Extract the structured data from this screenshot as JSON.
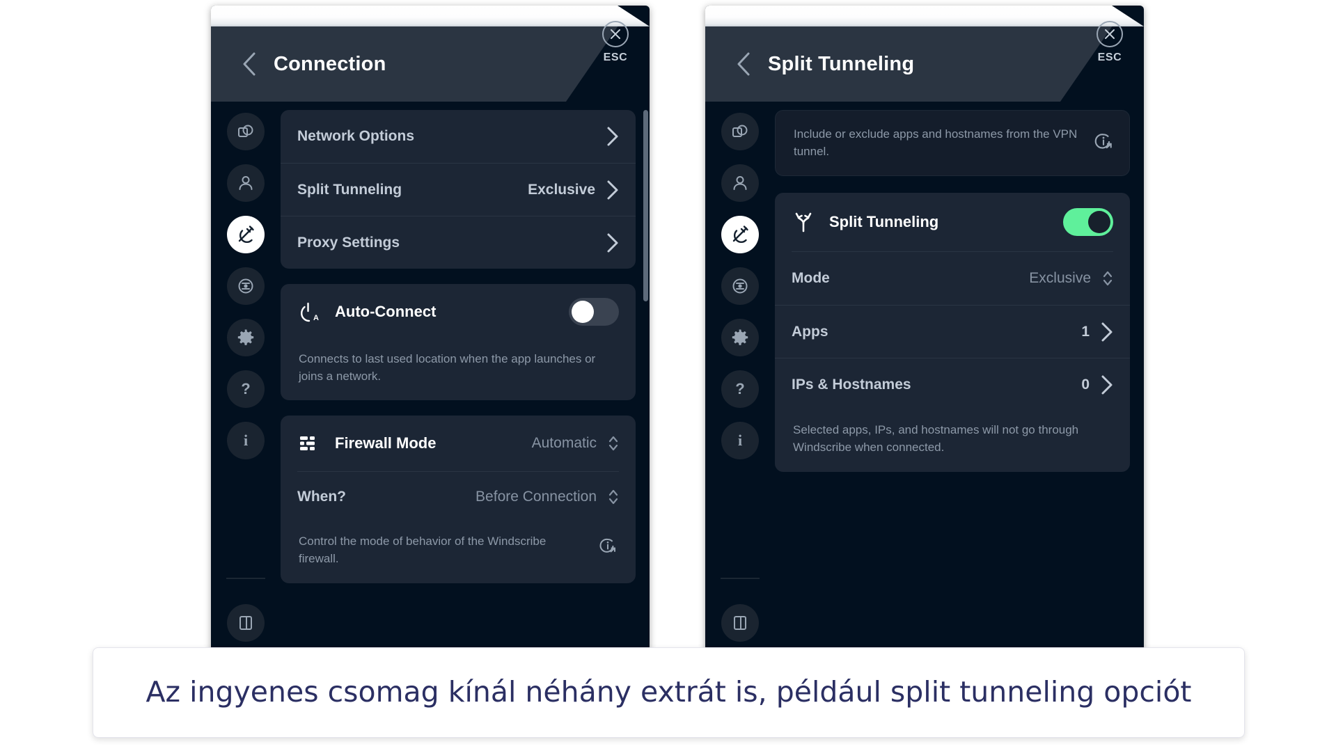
{
  "colors": {
    "window_bg": "#02101f",
    "header_bg": "#2b3542",
    "card_bg": "#1c2635",
    "accent_green": "#5ff09b",
    "muted_text": "#8d99a8",
    "label_text": "#c3ccd8",
    "caption_text": "#2b2f63"
  },
  "left_window": {
    "header": {
      "title": "Connection",
      "back_icon": "chevron-left-icon",
      "close_icon": "close-icon",
      "esc_label": "ESC"
    },
    "rail": [
      {
        "icon": "copy-icon",
        "active": false
      },
      {
        "icon": "account-icon",
        "active": false
      },
      {
        "icon": "connection-plug-icon",
        "active": true
      },
      {
        "icon": "robert-icon",
        "active": false
      },
      {
        "icon": "gear-icon",
        "active": false
      },
      {
        "icon": "help-question-icon",
        "active": false
      },
      {
        "icon": "info-icon",
        "active": false
      },
      {
        "icon": "logout-icon",
        "active": false
      }
    ],
    "menu_rows": [
      {
        "label": "Network Options",
        "value": "",
        "affordance": "chevron-right-icon"
      },
      {
        "label": "Split Tunneling",
        "value": "Exclusive",
        "affordance": "chevron-right-icon"
      },
      {
        "label": "Proxy Settings",
        "value": "",
        "affordance": "chevron-right-icon"
      }
    ],
    "auto_connect": {
      "icon": "power-auto-icon",
      "title": "Auto-Connect",
      "toggle_on": false,
      "description": "Connects to last used location when the app launches or joins a network."
    },
    "firewall": {
      "icon": "firewall-bricks-icon",
      "title": "Firewall Mode",
      "mode_value": "Automatic",
      "mode_affordance": "stepper-icon",
      "when_label": "When?",
      "when_value": "Before Connection",
      "when_affordance": "stepper-icon",
      "description": "Control the mode of behavior of the Windscribe firewall.",
      "description_info_icon": "info-external-link-icon"
    }
  },
  "right_window": {
    "header": {
      "title": "Split Tunneling",
      "back_icon": "chevron-left-icon",
      "close_icon": "close-icon",
      "esc_label": "ESC"
    },
    "rail": [
      {
        "icon": "copy-icon",
        "active": false
      },
      {
        "icon": "account-icon",
        "active": false
      },
      {
        "icon": "connection-plug-icon",
        "active": true
      },
      {
        "icon": "robert-icon",
        "active": false
      },
      {
        "icon": "gear-icon",
        "active": false
      },
      {
        "icon": "help-question-icon",
        "active": false
      },
      {
        "icon": "info-icon",
        "active": false
      },
      {
        "icon": "logout-icon",
        "active": false
      }
    ],
    "intro": {
      "text": "Include or exclude apps and hostnames from the VPN tunnel.",
      "info_icon": "info-external-link-icon"
    },
    "split_tunneling": {
      "icon": "split-fork-icon",
      "title": "Split Tunneling",
      "toggle_on": true
    },
    "settings_rows": [
      {
        "label": "Mode",
        "value": "Exclusive",
        "affordance": "stepper-icon"
      },
      {
        "label": "Apps",
        "value": "1",
        "affordance": "chevron-right-icon"
      },
      {
        "label": "IPs & Hostnames",
        "value": "0",
        "affordance": "chevron-right-icon"
      }
    ],
    "footer_note": "Selected apps, IPs, and hostnames will not go through Windscribe when connected."
  },
  "caption": {
    "text": "Az ingyenes csomag kínál néhány extrát is, például split tunneling opciót"
  }
}
